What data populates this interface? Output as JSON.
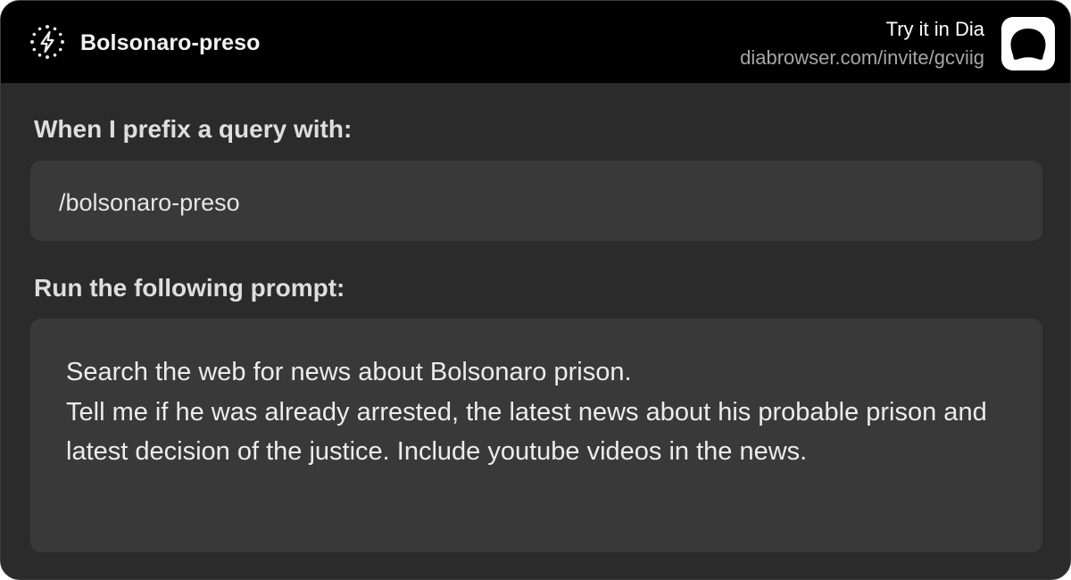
{
  "header": {
    "icon": "sparkle-bolt-icon",
    "title": "Bolsonaro-preso",
    "cta_label": "Try it in Dia",
    "invite_url": "diabrowser.com/invite/gcviig",
    "logo": "dia-logo-icon"
  },
  "shortcut": {
    "prefix_label": "When I prefix a query with:",
    "prefix_value": "/bolsonaro-preso",
    "prompt_label": "Run the following prompt:",
    "prompt_value": "Search the web for news about Bolsonaro prison.\nTell me if he was already arrested, the latest news about his probable prison and latest decision of the justice. Include youtube videos in the news."
  },
  "colors": {
    "header_bg": "#000000",
    "card_bg": "#2b2b2b",
    "field_bg": "#393939",
    "text_primary": "#f2f2f2",
    "text_muted": "#a6a6a6"
  }
}
